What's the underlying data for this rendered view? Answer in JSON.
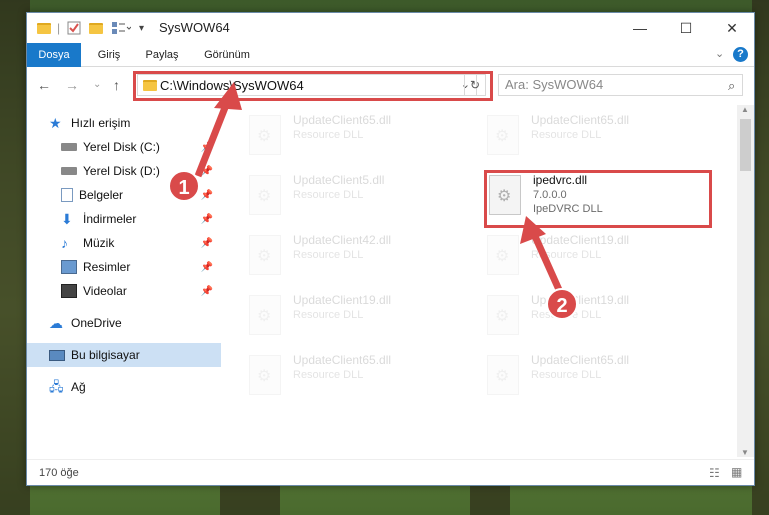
{
  "window": {
    "title": "SysWOW64"
  },
  "ribbon": {
    "tabs": [
      "Dosya",
      "Giriş",
      "Paylaş",
      "Görünüm"
    ],
    "help": "?"
  },
  "window_buttons": {
    "minimize": "—",
    "maximize": "☐",
    "close": "✕"
  },
  "navigation": {
    "address": "C:\\Windows\\SysWOW64",
    "search_placeholder": "Ara: SysWOW64"
  },
  "sidebar": {
    "items": [
      {
        "label": "Hızlı erişim",
        "icon": "star-icon",
        "pinned": false
      },
      {
        "label": "Yerel Disk (C:)",
        "icon": "drive-icon",
        "pinned": true
      },
      {
        "label": "Yerel Disk (D:)",
        "icon": "drive-icon",
        "pinned": true
      },
      {
        "label": "Belgeler",
        "icon": "documents-icon",
        "pinned": true
      },
      {
        "label": "İndirmeler",
        "icon": "downloads-icon",
        "pinned": true
      },
      {
        "label": "Müzik",
        "icon": "music-icon",
        "pinned": true
      },
      {
        "label": "Resimler",
        "icon": "pictures-icon",
        "pinned": true
      },
      {
        "label": "Videolar",
        "icon": "videos-icon",
        "pinned": true
      },
      {
        "label": "OneDrive",
        "icon": "cloud-icon",
        "pinned": false
      },
      {
        "label": "Bu bilgisayar",
        "icon": "computer-icon",
        "pinned": false,
        "selected": true
      },
      {
        "label": "Ağ",
        "icon": "network-icon",
        "pinned": false
      }
    ]
  },
  "files": [
    {
      "name": "UpdateClient65.dll",
      "desc": "Resource DLL"
    },
    {
      "name": "UpdateClient65.dll",
      "desc": "Resource DLL"
    },
    {
      "name": "UpdateClient5.dll",
      "desc": "Resource DLL"
    },
    {
      "name": "ipedvrc.dll",
      "version": "7.0.0.0",
      "desc": "IpeDVRC DLL",
      "highlighted": true
    },
    {
      "name": "UpdateClient42.dll",
      "desc": "Resource DLL"
    },
    {
      "name": "UpdateClient19.dll",
      "desc": "Resource DLL"
    },
    {
      "name": "UpdateClient19.dll",
      "desc": "Resource DLL"
    },
    {
      "name": "UpdateClient19.dll",
      "desc": "Resource DLL"
    },
    {
      "name": "UpdateClient65.dll",
      "desc": "Resource DLL"
    },
    {
      "name": "UpdateClient65.dll",
      "desc": "Resource DLL"
    }
  ],
  "status": {
    "count": "170 öğe"
  },
  "callouts": [
    "1",
    "2"
  ],
  "colors": {
    "accent": "#1979ca",
    "highlight": "#d94a4a",
    "selected_bg": "#cce0f4"
  }
}
